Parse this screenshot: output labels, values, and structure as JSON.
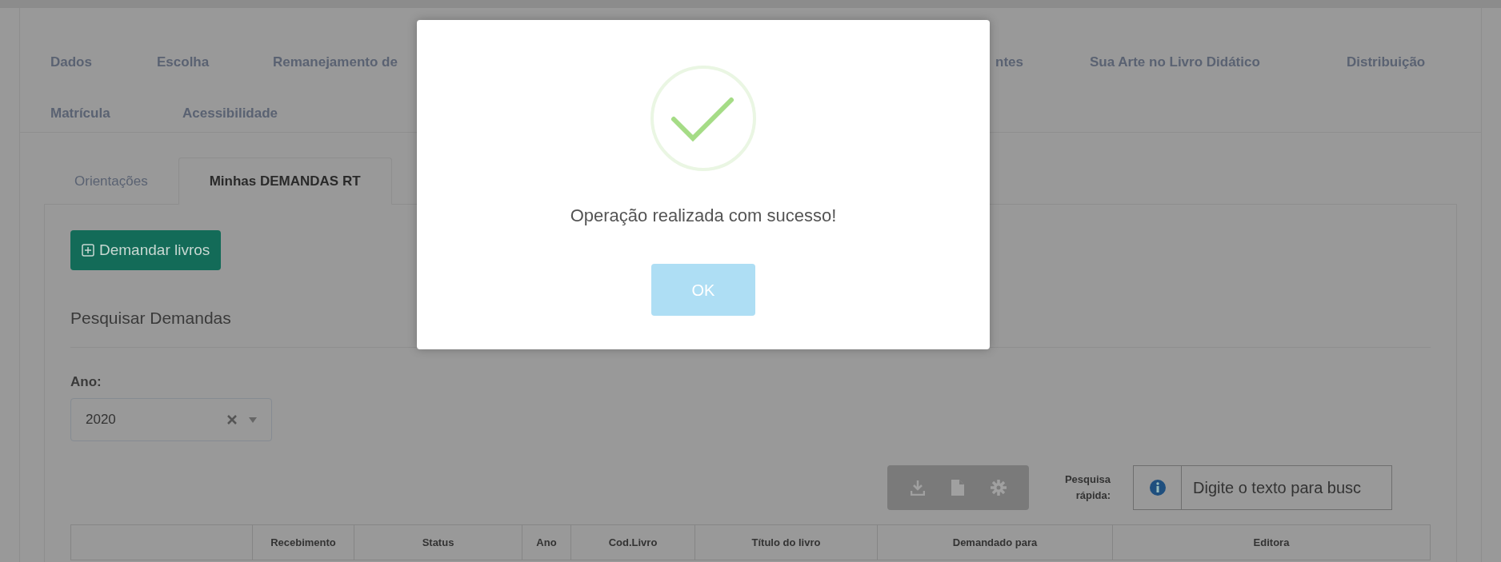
{
  "nav_rows": [
    {
      "items": [
        {
          "label": "Dados"
        },
        {
          "label": "Escolha"
        },
        {
          "label": "Remanejamento de"
        },
        {
          "label": "ntes"
        },
        {
          "label": "Sua Arte no Livro Didático"
        },
        {
          "label": "Distribuição"
        }
      ]
    },
    {
      "items": [
        {
          "label": "Matrícula"
        },
        {
          "label": "Acessibilidade"
        }
      ]
    }
  ],
  "sub_tabs": [
    {
      "label": "Orientações",
      "selected": false
    },
    {
      "label": "Minhas DEMANDAS RT",
      "selected": true
    }
  ],
  "add_button": "Demandar livros",
  "section_title": "Pesquisar Demandas",
  "year_filter": {
    "label": "Ano:",
    "value": "2020"
  },
  "quick_search": {
    "label": "Pesquisa rápida:",
    "placeholder": "Digite o texto para busc"
  },
  "table": {
    "columns": [
      "Recebimento",
      "Status",
      "Ano",
      "Cod.Livro",
      "Título do livro",
      "Demandado para",
      "Editora"
    ]
  },
  "dialog": {
    "message": "Operação realizada com sucesso!",
    "button": "OK"
  }
}
